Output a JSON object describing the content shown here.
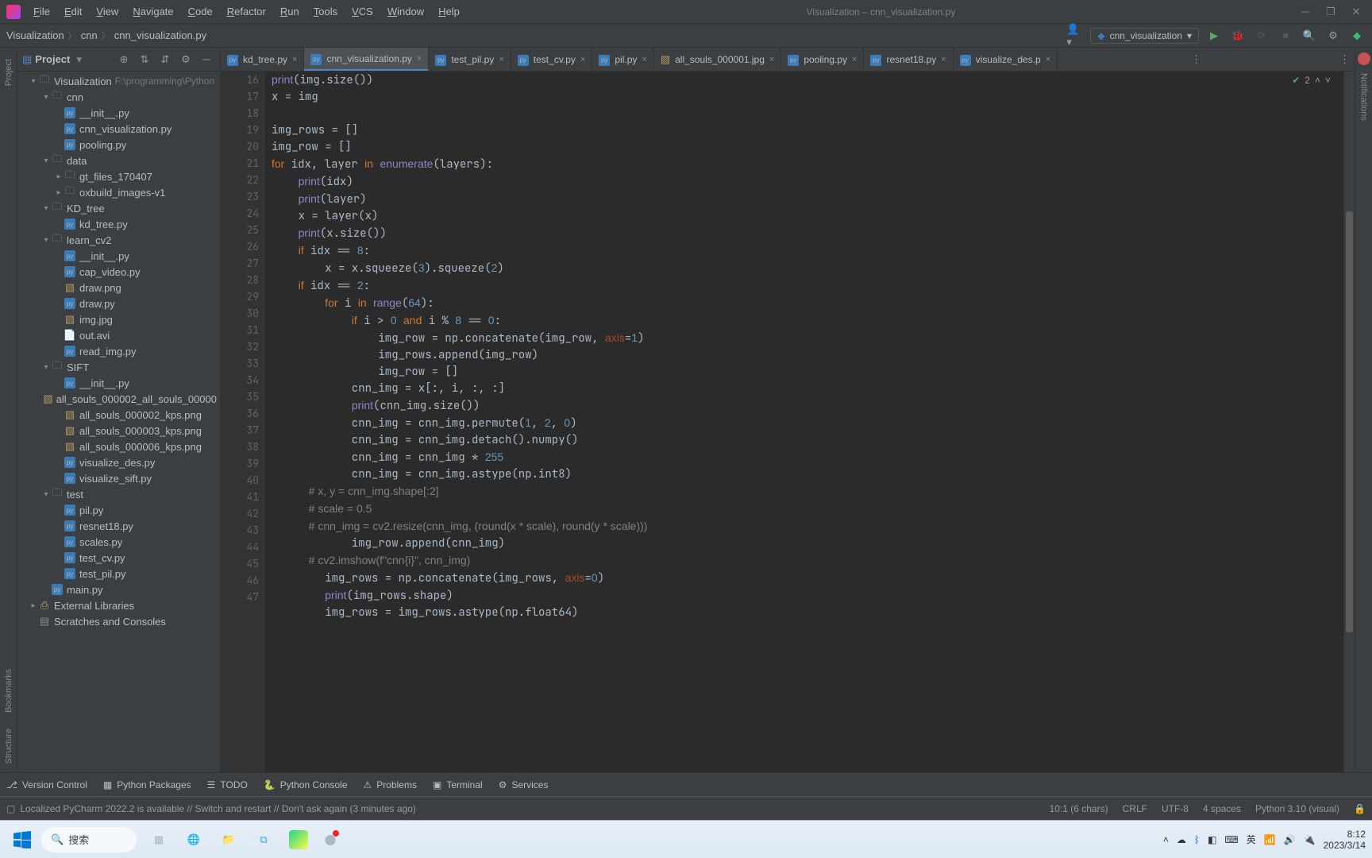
{
  "window": {
    "title": "Visualization – cnn_visualization.py",
    "menus": [
      "File",
      "Edit",
      "View",
      "Navigate",
      "Code",
      "Refactor",
      "Run",
      "Tools",
      "VCS",
      "Window",
      "Help"
    ]
  },
  "breadcrumb": [
    "Visualization",
    "cnn",
    "cnn_visualization.py"
  ],
  "run_config": "cnn_visualization",
  "project_panel": {
    "title": "Project",
    "root": {
      "name": "Visualization",
      "path": "F:\\programming\\Python"
    },
    "tree": [
      {
        "depth": 0,
        "type": "folder-open",
        "name": "Visualization",
        "path": "F:\\programming\\Python",
        "expanded": true
      },
      {
        "depth": 1,
        "type": "folder-open",
        "name": "cnn",
        "expanded": true
      },
      {
        "depth": 2,
        "type": "py",
        "name": "__init__.py"
      },
      {
        "depth": 2,
        "type": "py",
        "name": "cnn_visualization.py"
      },
      {
        "depth": 2,
        "type": "py",
        "name": "pooling.py"
      },
      {
        "depth": 1,
        "type": "folder-open",
        "name": "data",
        "expanded": true
      },
      {
        "depth": 2,
        "type": "folder",
        "name": "gt_files_170407",
        "expanded": false
      },
      {
        "depth": 2,
        "type": "folder",
        "name": "oxbuild_images-v1",
        "expanded": false
      },
      {
        "depth": 1,
        "type": "folder-open",
        "name": "KD_tree",
        "expanded": true
      },
      {
        "depth": 2,
        "type": "py",
        "name": "kd_tree.py"
      },
      {
        "depth": 1,
        "type": "folder-open",
        "name": "learn_cv2",
        "expanded": true
      },
      {
        "depth": 2,
        "type": "py",
        "name": "__init__.py"
      },
      {
        "depth": 2,
        "type": "py",
        "name": "cap_video.py"
      },
      {
        "depth": 2,
        "type": "img",
        "name": "draw.png"
      },
      {
        "depth": 2,
        "type": "py",
        "name": "draw.py"
      },
      {
        "depth": 2,
        "type": "img",
        "name": "img.jpg"
      },
      {
        "depth": 2,
        "type": "file",
        "name": "out.avi"
      },
      {
        "depth": 2,
        "type": "py",
        "name": "read_img.py"
      },
      {
        "depth": 1,
        "type": "folder-open",
        "name": "SIFT",
        "expanded": true
      },
      {
        "depth": 2,
        "type": "py",
        "name": "__init__.py"
      },
      {
        "depth": 2,
        "type": "img",
        "name": "all_souls_000002_all_souls_00000"
      },
      {
        "depth": 2,
        "type": "img",
        "name": "all_souls_000002_kps.png"
      },
      {
        "depth": 2,
        "type": "img",
        "name": "all_souls_000003_kps.png"
      },
      {
        "depth": 2,
        "type": "img",
        "name": "all_souls_000006_kps.png"
      },
      {
        "depth": 2,
        "type": "py",
        "name": "visualize_des.py"
      },
      {
        "depth": 2,
        "type": "py",
        "name": "visualize_sift.py"
      },
      {
        "depth": 1,
        "type": "folder-open",
        "name": "test",
        "expanded": true
      },
      {
        "depth": 2,
        "type": "py",
        "name": "pil.py"
      },
      {
        "depth": 2,
        "type": "py",
        "name": "resnet18.py"
      },
      {
        "depth": 2,
        "type": "py",
        "name": "scales.py"
      },
      {
        "depth": 2,
        "type": "py",
        "name": "test_cv.py"
      },
      {
        "depth": 2,
        "type": "py",
        "name": "test_pil.py"
      },
      {
        "depth": 1,
        "type": "py",
        "name": "main.py"
      },
      {
        "depth": 0,
        "type": "lib",
        "name": "External Libraries",
        "expanded": false
      },
      {
        "depth": 0,
        "type": "scratch",
        "name": "Scratches and Consoles"
      }
    ]
  },
  "tabs": [
    {
      "name": "kd_tree.py",
      "type": "py",
      "active": false
    },
    {
      "name": "cnn_visualization.py",
      "type": "py",
      "active": true
    },
    {
      "name": "test_pil.py",
      "type": "py",
      "active": false
    },
    {
      "name": "test_cv.py",
      "type": "py",
      "active": false
    },
    {
      "name": "pil.py",
      "type": "py",
      "active": false
    },
    {
      "name": "all_souls_000001.jpg",
      "type": "img",
      "active": false
    },
    {
      "name": "pooling.py",
      "type": "py",
      "active": false
    },
    {
      "name": "resnet18.py",
      "type": "py",
      "active": false
    },
    {
      "name": "visualize_des.p",
      "type": "py",
      "active": false
    }
  ],
  "editor": {
    "first_line_no": 16,
    "inspection": {
      "warnings": 2
    },
    "lines": [
      "print(img.size())",
      "x = img",
      "",
      "img_rows = []",
      "img_row = []",
      "for idx, layer in enumerate(layers):",
      "    print(idx)",
      "    print(layer)",
      "    x = layer(x)",
      "    print(x.size())",
      "    if idx == 8:",
      "        x = x.squeeze(3).squeeze(2)",
      "    if idx == 2:",
      "        for i in range(64):",
      "            if i > 0 and i % 8 == 0:",
      "                img_row = np.concatenate(img_row, axis=1)",
      "                img_rows.append(img_row)",
      "                img_row = []",
      "            cnn_img = x[:, i, :, :]",
      "            print(cnn_img.size())",
      "            cnn_img = cnn_img.permute(1, 2, 0)",
      "            cnn_img = cnn_img.detach().numpy()",
      "            cnn_img = cnn_img * 255",
      "            cnn_img = cnn_img.astype(np.int8)",
      "            # x, y = cnn_img.shape[:2]",
      "            # scale = 0.5",
      "            # cnn_img = cv2.resize(cnn_img, (round(x * scale), round(y * scale)))",
      "            img_row.append(cnn_img)",
      "            # cv2.imshow(f\"cnn{i}\", cnn_img)",
      "        img_rows = np.concatenate(img_rows, axis=0)",
      "        print(img_rows.shape)",
      "        img_rows = img_rows.astype(np.float64)"
    ]
  },
  "left_strip": [
    "Project",
    "Bookmarks",
    "Structure"
  ],
  "right_strip": [
    "Notifications"
  ],
  "bottom_tools": [
    "Version Control",
    "Python Packages",
    "TODO",
    "Python Console",
    "Problems",
    "Terminal",
    "Services"
  ],
  "status": {
    "message": "Localized PyCharm 2022.2 is available // Switch and restart // Don't ask again (3 minutes ago)",
    "caret": "10:1 (6 chars)",
    "line_sep": "CRLF",
    "encoding": "UTF-8",
    "indent": "4 spaces",
    "interpreter": "Python 3.10 (visual)"
  },
  "taskbar": {
    "search_label": "搜索",
    "time": "8:12",
    "date": "2023/3/14"
  }
}
